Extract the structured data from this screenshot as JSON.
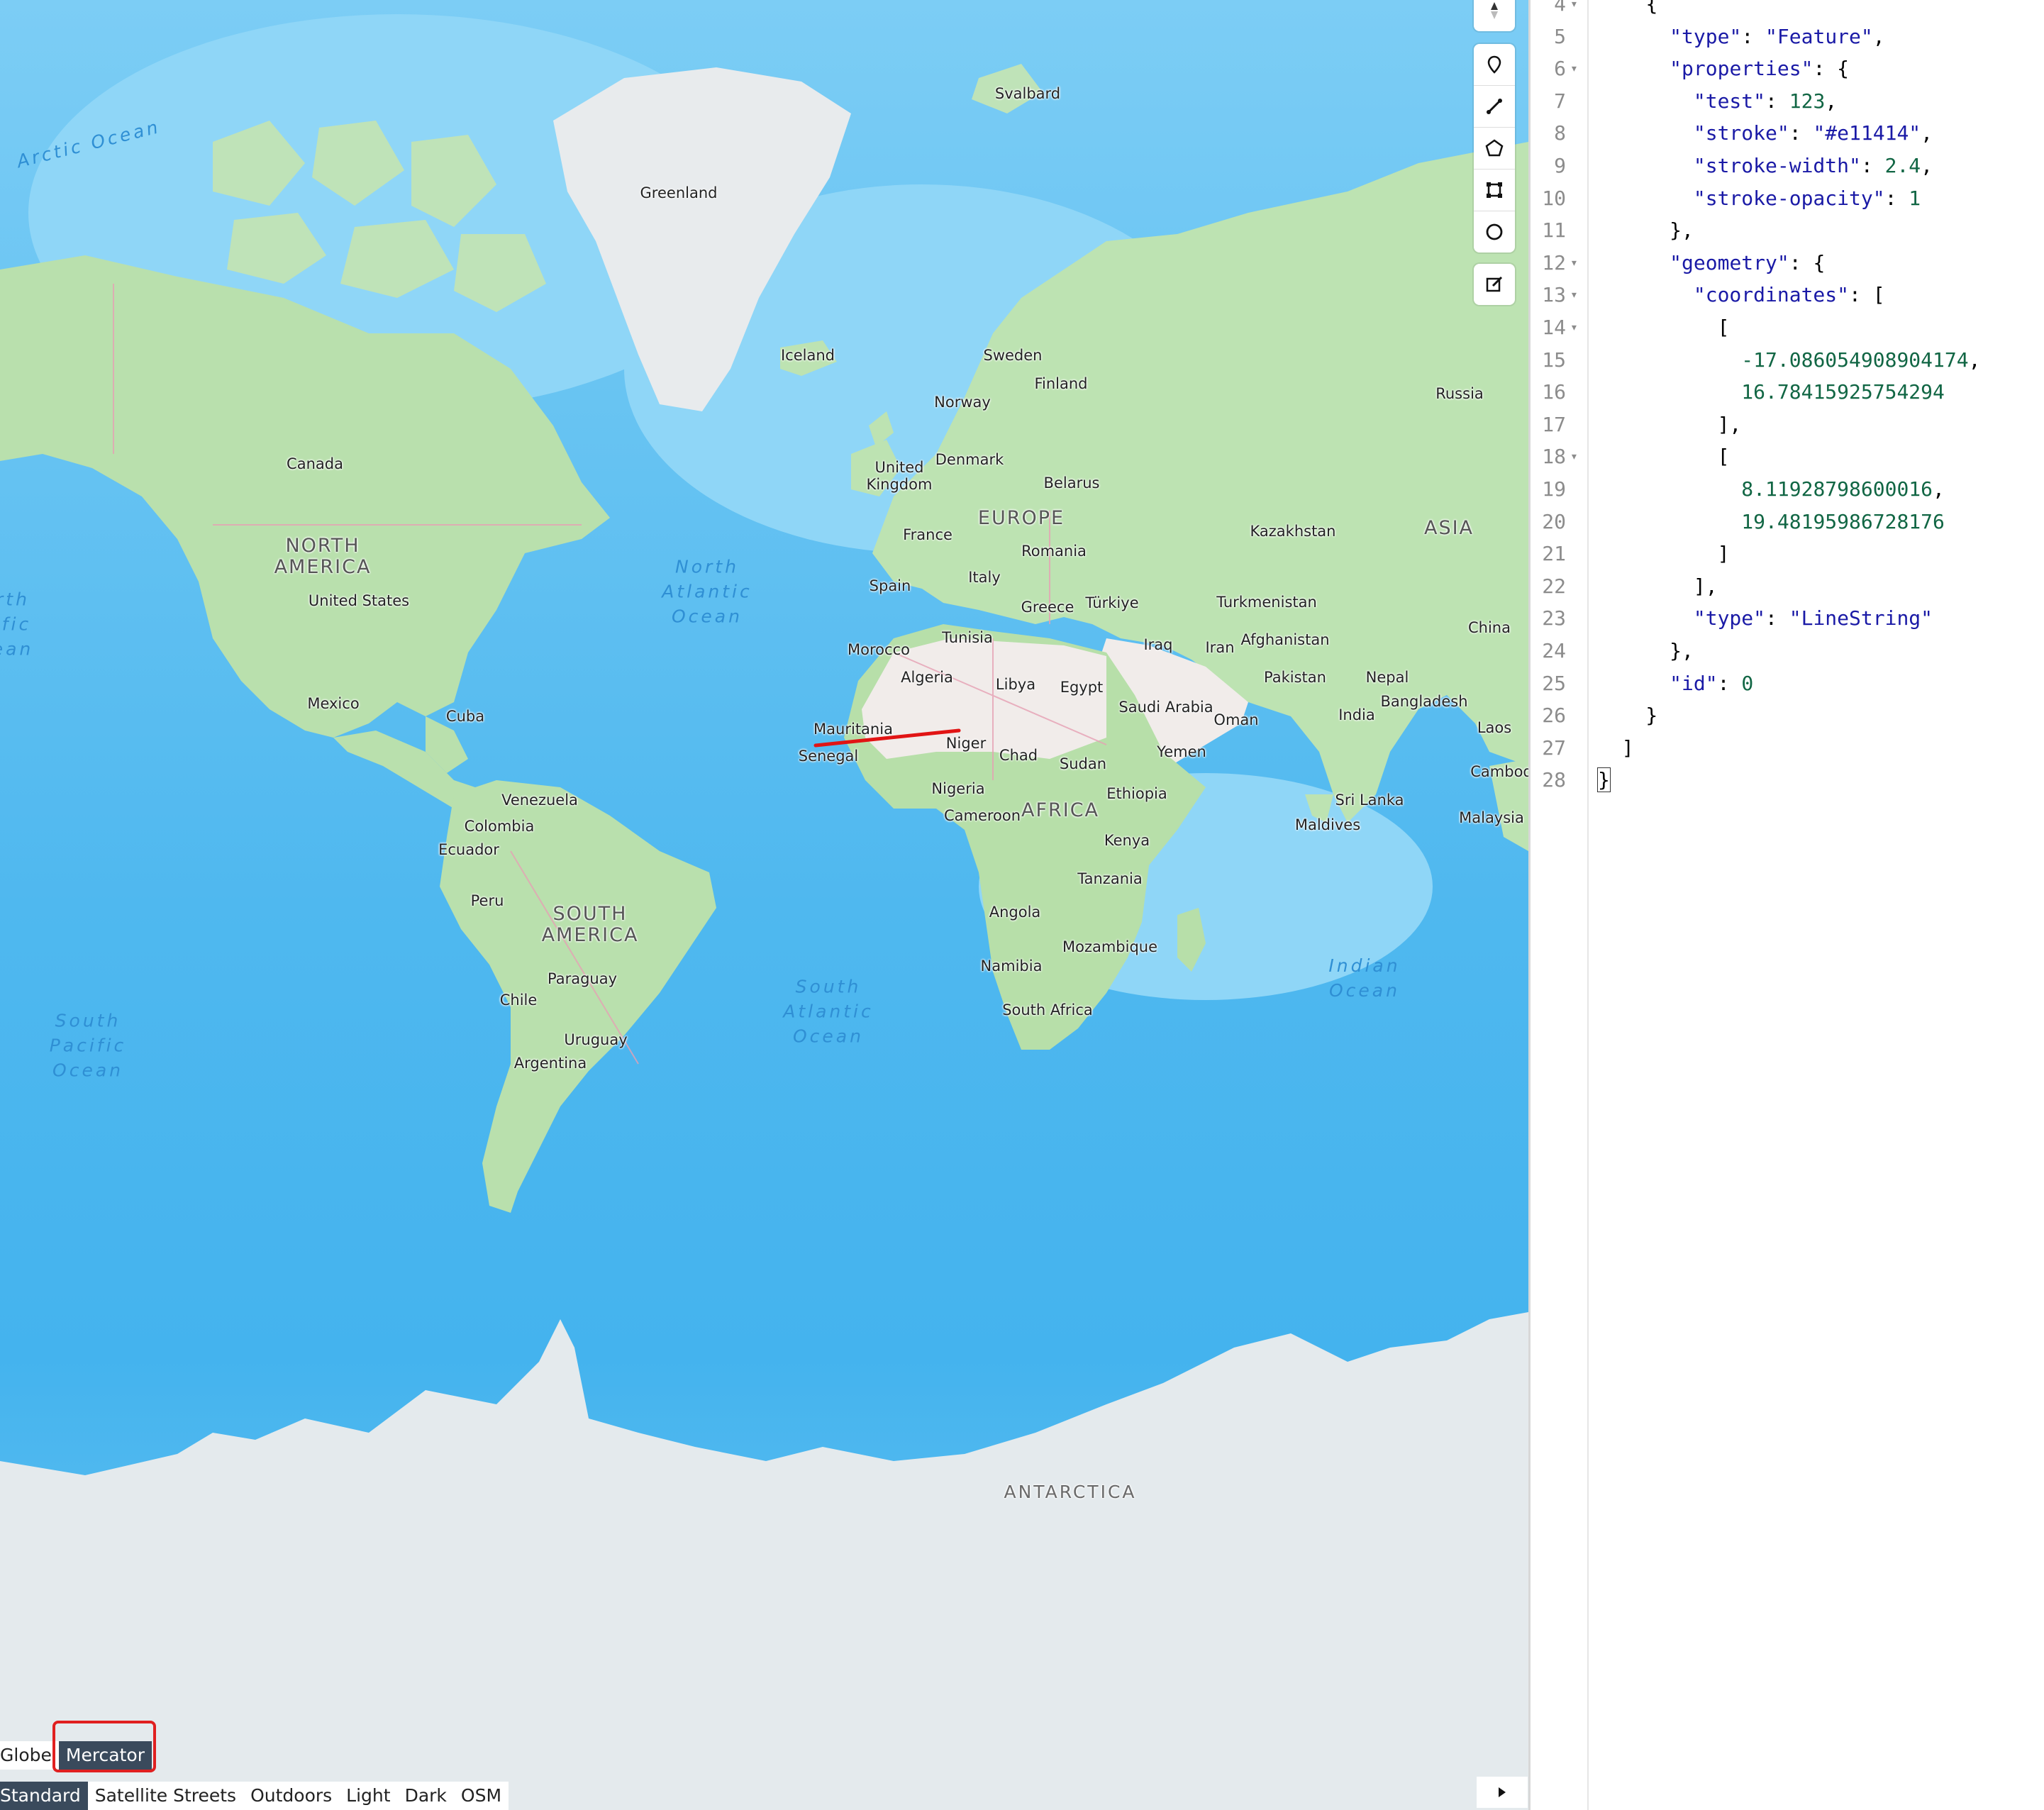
{
  "map": {
    "labels": {
      "arctic_ocean": "Arctic Ocean",
      "svalbard": "Svalbard",
      "greenland": "Greenland",
      "iceland": "Iceland",
      "sweden": "Sweden",
      "finland": "Finland",
      "norway": "Norway",
      "russia": "Russia",
      "canada": "Canada",
      "united_kingdom": "United\nKingdom",
      "denmark": "Denmark",
      "belarus": "Belarus",
      "north_america": "NORTH\nAMERICA",
      "europe": "EUROPE",
      "france": "France",
      "romania": "Romania",
      "kazakhstan": "Kazakhstan",
      "asia": "ASIA",
      "united_states": "United States",
      "north_atlantic": "North\nAtlantic\nOcean",
      "spain": "Spain",
      "italy": "Italy",
      "greece": "Greece",
      "turkiye": "Türkiye",
      "turkmenistan": "Turkmenistan",
      "tunisia": "Tunisia",
      "morocco": "Morocco",
      "iraq": "Iraq",
      "iran": "Iran",
      "afghanistan": "Afghanistan",
      "china": "China",
      "algeria": "Algeria",
      "libya": "Libya",
      "egypt": "Egypt",
      "pakistan": "Pakistan",
      "nepal": "Nepal",
      "mexico": "Mexico",
      "cuba": "Cuba",
      "saudi_arabia": "Saudi Arabia",
      "bangladesh": "Bangladesh",
      "india": "India",
      "oman": "Oman",
      "mauritania": "Mauritania",
      "laos": "Laos",
      "niger": "Niger",
      "senegal": "Senegal",
      "chad": "Chad",
      "sudan": "Sudan",
      "yemen": "Yemen",
      "cambodia": "Cambod",
      "nigeria": "Nigeria",
      "ethiopia": "Ethiopia",
      "venezuela": "Venezuela",
      "sri_lanka": "Sri Lanka",
      "colombia": "Colombia",
      "cameroon": "Cameroon",
      "africa": "AFRICA",
      "malaysia": "Malaysia",
      "maldives": "Maldives",
      "ecuador": "Ecuador",
      "kenya": "Kenya",
      "tanzania": "Tanzania",
      "peru": "Peru",
      "south_america": "SOUTH\nAMERICA",
      "angola": "Angola",
      "mozambique": "Mozambique",
      "indian_ocean": "Indian\nOcean",
      "paraguay": "Paraguay",
      "namibia": "Namibia",
      "south_atlantic": "South\nAtlantic\nOcean",
      "chile": "Chile",
      "south_africa": "South Africa",
      "south_pacific": "South\nPacific\nOcean",
      "uruguay": "Uruguay",
      "argentina": "Argentina",
      "north_pacific_partial": "rth\nific\nean",
      "antarctica": "ANTARCTICA"
    },
    "feature_line": {
      "color": "#e11414",
      "width": 2.4
    }
  },
  "toolbar": {
    "tools": [
      "compass-icon",
      "marker-icon",
      "line-icon",
      "polygon-icon",
      "rectangle-icon",
      "circle-icon"
    ],
    "edit": "edit-icon"
  },
  "projection": {
    "globe": "Globe",
    "mercator": "Mercator",
    "selected": "Mercator"
  },
  "styles": {
    "items": [
      "Standard",
      "Satellite Streets",
      "Outdoors",
      "Light",
      "Dark",
      "OSM"
    ],
    "selected": "Standard"
  },
  "editor": {
    "lines": [
      {
        "n": "4",
        "fold": true
      },
      {
        "n": "5",
        "fold": false
      },
      {
        "n": "6",
        "fold": true
      },
      {
        "n": "7",
        "fold": false
      },
      {
        "n": "8",
        "fold": false
      },
      {
        "n": "9",
        "fold": false
      },
      {
        "n": "10",
        "fold": false
      },
      {
        "n": "11",
        "fold": false
      },
      {
        "n": "12",
        "fold": true
      },
      {
        "n": "13",
        "fold": true
      },
      {
        "n": "14",
        "fold": true
      },
      {
        "n": "15",
        "fold": false
      },
      {
        "n": "16",
        "fold": false
      },
      {
        "n": "17",
        "fold": false
      },
      {
        "n": "18",
        "fold": true
      },
      {
        "n": "19",
        "fold": false
      },
      {
        "n": "20",
        "fold": false
      },
      {
        "n": "21",
        "fold": false
      },
      {
        "n": "22",
        "fold": false
      },
      {
        "n": "23",
        "fold": false
      },
      {
        "n": "24",
        "fold": false
      },
      {
        "n": "25",
        "fold": false
      },
      {
        "n": "26",
        "fold": false
      },
      {
        "n": "27",
        "fold": false
      },
      {
        "n": "28",
        "fold": false
      }
    ],
    "tokens": {
      "l4": "{",
      "type_key": "\"type\"",
      "feature_val": "\"Feature\"",
      "properties_key": "\"properties\"",
      "test_key": "\"test\"",
      "test_val": "123",
      "stroke_key": "\"stroke\"",
      "stroke_val": "\"#e11414\"",
      "stroke_width_key": "\"stroke-width\"",
      "stroke_width_val": "2.4",
      "stroke_opacity_key": "\"stroke-opacity\"",
      "stroke_opacity_val": "1",
      "geometry_key": "\"geometry\"",
      "coordinates_key": "\"coordinates\"",
      "c1": "-17.086054908904174",
      "c2": "16.78415925754294",
      "c3": "8.11928798600016",
      "c4": "19.48195986728176",
      "type_key2": "\"type\"",
      "linestring_val": "\"LineString\"",
      "id_key": "\"id\"",
      "id_val": "0"
    }
  }
}
